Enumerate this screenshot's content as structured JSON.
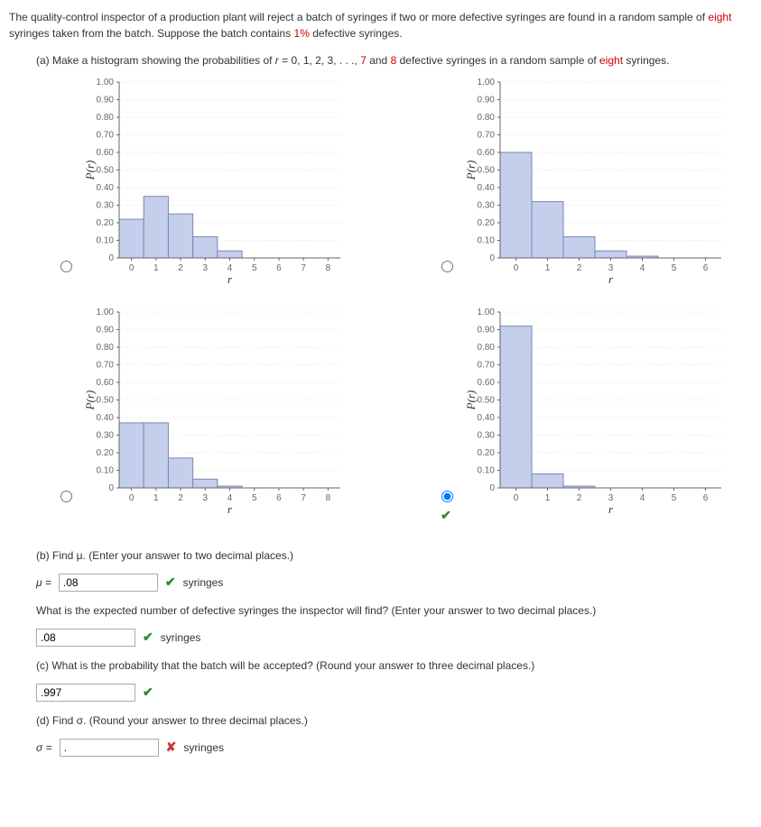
{
  "intro": {
    "p1_a": "The quality-control inspector of a production plant will reject a batch of syringes if two or more defective syringes are found in a random sample of ",
    "eight": "eight",
    "p1_b": " syringes taken from the batch. Suppose the batch contains ",
    "onepct": "1%",
    "p1_c": " defective syringes."
  },
  "part_a": {
    "label_a": "(a) Make a histogram showing the probabilities of ",
    "r_eq": "r",
    "label_b": " = 0, 1, 2, 3, . . ., ",
    "seven": "7",
    "label_c": " and ",
    "eight": "8",
    "label_d": " defective syringes in a random sample of ",
    "eight2": "eight",
    "label_e": " syringes."
  },
  "axis": {
    "x": "r",
    "y": "P(r)"
  },
  "yticks": [
    "0",
    "0.10",
    "0.20",
    "0.30",
    "0.40",
    "0.50",
    "0.60",
    "0.70",
    "0.80",
    "0.90",
    "1.00"
  ],
  "xticks9": [
    "0",
    "1",
    "2",
    "3",
    "4",
    "5",
    "6",
    "7",
    "8"
  ],
  "xticks7": [
    "0",
    "1",
    "2",
    "3",
    "4",
    "5",
    "6"
  ],
  "chart_data": [
    {
      "type": "bar",
      "categories": [
        0,
        1,
        2,
        3,
        4,
        5,
        6,
        7,
        8
      ],
      "values": [
        0.22,
        0.35,
        0.25,
        0.12,
        0.04,
        0,
        0,
        0,
        0
      ],
      "xlabel": "r",
      "ylabel": "P(r)",
      "ylim": [
        0,
        1
      ]
    },
    {
      "type": "bar",
      "categories": [
        0,
        1,
        2,
        3,
        4,
        5,
        6
      ],
      "values": [
        0.6,
        0.32,
        0.12,
        0.04,
        0.01,
        0,
        0
      ],
      "xlabel": "r",
      "ylabel": "P(r)",
      "ylim": [
        0,
        1
      ]
    },
    {
      "type": "bar",
      "categories": [
        0,
        1,
        2,
        3,
        4,
        5,
        6,
        7,
        8
      ],
      "values": [
        0.37,
        0.37,
        0.17,
        0.05,
        0.01,
        0,
        0,
        0,
        0
      ],
      "xlabel": "r",
      "ylabel": "P(r)",
      "ylim": [
        0,
        1
      ]
    },
    {
      "type": "bar",
      "categories": [
        0,
        1,
        2,
        3,
        4,
        5,
        6
      ],
      "values": [
        0.92,
        0.08,
        0.01,
        0,
        0,
        0,
        0
      ],
      "xlabel": "r",
      "ylabel": "P(r)",
      "ylim": [
        0,
        1
      ]
    }
  ],
  "part_b": {
    "q1": "(b) Find μ. (Enter your answer to two decimal places.)",
    "mu_prefix": "μ = ",
    "mu_val": ".08",
    "unit": "syringes",
    "q2": "What is the expected number of defective syringes the inspector will find? (Enter your answer to two decimal places.)",
    "exp_val": ".08"
  },
  "part_c": {
    "q": "(c) What is the probability that the batch will be accepted? (Round your answer to three decimal places.)",
    "val": ".997"
  },
  "part_d": {
    "q": "(d) Find σ. (Round your answer to three decimal places.)",
    "sigma_prefix": "σ = ",
    "val": ".",
    "unit": "syringes"
  }
}
